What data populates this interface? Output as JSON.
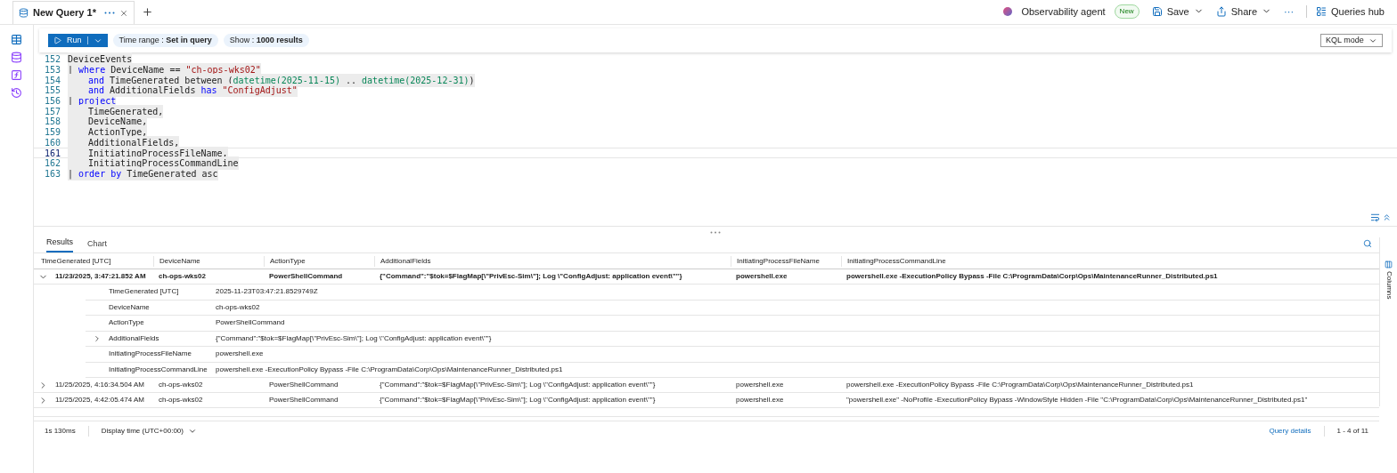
{
  "tabs": [
    {
      "label": "New Query 1*",
      "selected": true
    }
  ],
  "top_actions": {
    "agent": "Observability agent",
    "badge": "New",
    "save": "Save",
    "share": "Share",
    "more": "···",
    "hub": "Queries hub"
  },
  "toolbar": {
    "run": "Run",
    "time_range_label": "Time range :",
    "time_range_value": "Set in query",
    "show_label": "Show :",
    "show_value": "1000 results",
    "mode": "KQL mode"
  },
  "editor": {
    "lines": [
      {
        "number": "152",
        "current": false,
        "indent": false,
        "tokens": [
          {
            "kind": "plain",
            "text": "DeviceEvents"
          }
        ]
      },
      {
        "number": "153",
        "current": false,
        "indent": false,
        "tokens": [
          {
            "kind": "plain",
            "text": "| "
          },
          {
            "kind": "keyword",
            "text": "where"
          },
          {
            "kind": "plain",
            "text": " DeviceName == "
          },
          {
            "kind": "string",
            "text": "\"ch-ops-wks02\""
          }
        ]
      },
      {
        "number": "154",
        "current": false,
        "indent": true,
        "tokens": [
          {
            "kind": "keyword",
            "text": "and"
          },
          {
            "kind": "plain",
            "text": " TimeGenerated between ("
          },
          {
            "kind": "func",
            "text": "datetime(2025-11-15)"
          },
          {
            "kind": "plain",
            "text": " .. "
          },
          {
            "kind": "func",
            "text": "datetime(2025-12-31)"
          },
          {
            "kind": "plain",
            "text": ")"
          }
        ]
      },
      {
        "number": "155",
        "current": false,
        "indent": true,
        "tokens": [
          {
            "kind": "keyword",
            "text": "and"
          },
          {
            "kind": "plain",
            "text": " AdditionalFields "
          },
          {
            "kind": "keyword",
            "text": "has"
          },
          {
            "kind": "string",
            "text": " \"ConfigAdjust\""
          }
        ]
      },
      {
        "number": "156",
        "current": false,
        "indent": false,
        "tokens": [
          {
            "kind": "plain",
            "text": "| "
          },
          {
            "kind": "keyword",
            "text": "project"
          }
        ]
      },
      {
        "number": "157",
        "current": false,
        "indent": true,
        "tokens": [
          {
            "kind": "plain",
            "text": "TimeGenerated,"
          }
        ]
      },
      {
        "number": "158",
        "current": false,
        "indent": true,
        "tokens": [
          {
            "kind": "plain",
            "text": "DeviceName,"
          }
        ]
      },
      {
        "number": "159",
        "current": false,
        "indent": true,
        "tokens": [
          {
            "kind": "plain",
            "text": "ActionType,"
          }
        ]
      },
      {
        "number": "160",
        "current": false,
        "indent": true,
        "tokens": [
          {
            "kind": "plain",
            "text": "AdditionalFields,"
          }
        ]
      },
      {
        "number": "161",
        "current": true,
        "indent": true,
        "tokens": [
          {
            "kind": "plain",
            "text": "InitiatingProcessFileName,"
          }
        ]
      },
      {
        "number": "162",
        "current": false,
        "indent": true,
        "tokens": [
          {
            "kind": "plain",
            "text": "InitiatingProcessCommandLine"
          }
        ]
      },
      {
        "number": "163",
        "current": false,
        "indent": false,
        "tokens": [
          {
            "kind": "plain",
            "text": "| "
          },
          {
            "kind": "keyword",
            "text": "order by"
          },
          {
            "kind": "plain",
            "text": " TimeGenerated asc"
          }
        ]
      }
    ]
  },
  "results_tabs": [
    {
      "label": "Results",
      "selected": true
    },
    {
      "label": "Chart",
      "selected": false
    }
  ],
  "columns": [
    "TimeGenerated [UTC]",
    "DeviceName",
    "ActionType",
    "AdditionalFields",
    "InitiatingProcessFileName",
    "InitiatingProcessCommandLine"
  ],
  "rows": [
    {
      "expanded": true,
      "cells": [
        "11/23/2025, 3:47:21.852 AM",
        "ch-ops-wks02",
        "PowerShellCommand",
        "{\"Command\":\"$tok=$FlagMap[\\\"PrivEsc-Sim\\\"]; Log \\\"ConfigAdjust: application event\\\"\"}",
        "powershell.exe",
        "powershell.exe -ExecutionPolicy Bypass -File C:\\ProgramData\\Corp\\Ops\\MaintenanceRunner_Distributed.ps1"
      ],
      "details": [
        {
          "name": "TimeGenerated [UTC]",
          "value": "2025-11-23T03:47:21.8529749Z",
          "expandable": false
        },
        {
          "name": "DeviceName",
          "value": "ch-ops-wks02",
          "expandable": false
        },
        {
          "name": "ActionType",
          "value": "PowerShellCommand",
          "expandable": false
        },
        {
          "name": "AdditionalFields",
          "value": "{\"Command\":\"$tok=$FlagMap[\\\"PrivEsc-Sim\\\"]; Log \\\"ConfigAdjust: application event\\\"\"}",
          "expandable": true
        },
        {
          "name": "InitiatingProcessFileName",
          "value": "powershell.exe",
          "expandable": false
        },
        {
          "name": "InitiatingProcessCommandLine",
          "value": "powershell.exe -ExecutionPolicy Bypass -File C:\\ProgramData\\Corp\\Ops\\MaintenanceRunner_Distributed.ps1",
          "expandable": false
        }
      ]
    },
    {
      "expanded": false,
      "cells": [
        "11/25/2025, 4:16:34.504 AM",
        "ch-ops-wks02",
        "PowerShellCommand",
        "{\"Command\":\"$tok=$FlagMap[\\\"PrivEsc-Sim\\\"]; Log \\\"ConfigAdjust: application event\\\"\"}",
        "powershell.exe",
        "powershell.exe -ExecutionPolicy Bypass -File C:\\ProgramData\\Corp\\Ops\\MaintenanceRunner_Distributed.ps1"
      ]
    },
    {
      "expanded": false,
      "cells": [
        "11/25/2025, 4:42:05.474 AM",
        "ch-ops-wks02",
        "PowerShellCommand",
        "{\"Command\":\"$tok=$FlagMap[\\\"PrivEsc-Sim\\\"]; Log \\\"ConfigAdjust: application event\\\"\"}",
        "powershell.exe",
        "\"powershell.exe\" -NoProfile -ExecutionPolicy Bypass -WindowStyle Hidden -File \"C:\\ProgramData\\Corp\\Ops\\MaintenanceRunner_Distributed.ps1\""
      ]
    }
  ],
  "side_panel": "Columns",
  "footer": {
    "duration": "1s 130ms",
    "display_time": "Display time (UTC+00:00)",
    "details": "Query details",
    "count": "1 - 4 of 11"
  }
}
